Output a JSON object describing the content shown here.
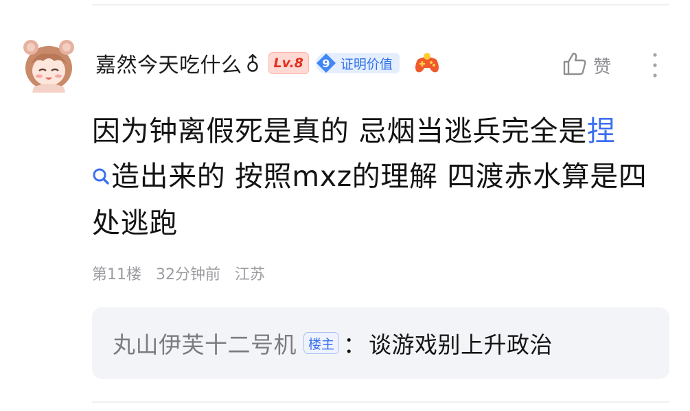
{
  "comment": {
    "username": "嘉然今天吃什么",
    "level": "Lv.8",
    "value_badge": {
      "number": "9",
      "label": "证明价值"
    },
    "like_label": "赞",
    "content": {
      "part1": "因为钟离假死是真的 忌烟当逃兵完全是",
      "link": "捏",
      "part2": "造出来的 按照mxz的理解 四渡赤水算是四处逃跑"
    },
    "meta": {
      "floor": "第11楼",
      "time": "32分钟前",
      "location": "江苏"
    }
  },
  "reply_preview": {
    "username": "丸山伊芙十二号机",
    "badge": "楼主",
    "colon": "：",
    "text": "谈游戏别上升政治"
  },
  "colors": {
    "accent": "#3a6ff0",
    "level_badge_bg": "#ffd9d3",
    "level_badge_text": "#e0311f",
    "reply_bg": "#f3f4f7"
  },
  "icons": [
    "avatar",
    "male-gender-icon",
    "value-diamond-icon",
    "game-controller-icon",
    "thumbs-up-icon",
    "more-vertical-icon",
    "search-icon"
  ]
}
